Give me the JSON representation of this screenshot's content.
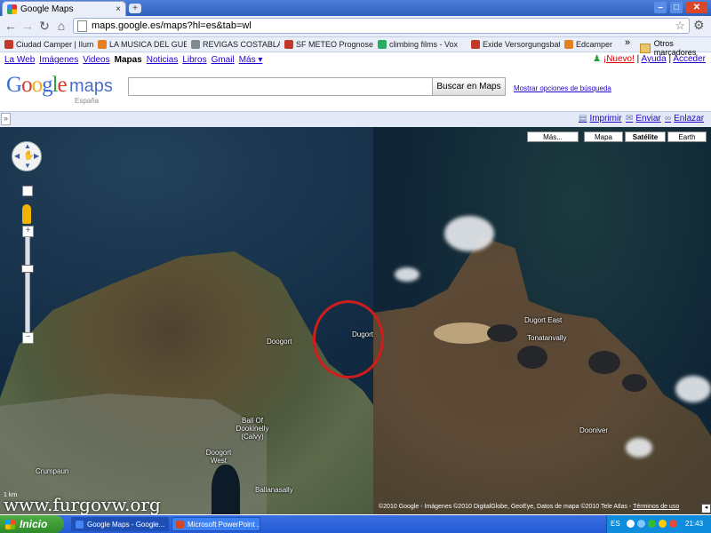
{
  "browser": {
    "tab_title": "Google Maps",
    "tab_close": "×",
    "new_tab": "+",
    "url": "maps.google.es/maps?hl=es&tab=wl",
    "window_buttons": {
      "minimize": "–",
      "maximize": "□",
      "close": "✕"
    }
  },
  "bookmarks": [
    {
      "label": "Ciudad Camper | Ilumi...",
      "color": "#c0392b"
    },
    {
      "label": "LA MUSICA DEL GUET...",
      "color": "#e67e22"
    },
    {
      "label": "REVIGAS COSTABLAN...",
      "color": "#7f8c8d"
    },
    {
      "label": "SF METEO Prognosen...",
      "color": "#c0392b"
    },
    {
      "label": "climbing films - Vox",
      "color": "#27ae60"
    },
    {
      "label": "Exide Versorgungsbat...",
      "color": "#c0392b"
    },
    {
      "label": "Edcamper",
      "color": "#e67e22"
    }
  ],
  "bookmarks_more": "»",
  "bookmarks_other": "Otros marcadores",
  "gbar": {
    "links": [
      "La Web",
      "Imágenes",
      "Videos",
      "Mapas",
      "Noticias",
      "Libros",
      "Gmail",
      "Más ▾"
    ],
    "current": "Mapas",
    "nuevo": "¡Nuevo!",
    "ayuda": "Ayuda",
    "acceder": "Acceder",
    "sep": "|"
  },
  "logo": {
    "google": "Google",
    "maps": "maps",
    "region": "España"
  },
  "search": {
    "value": "",
    "button": "Buscar en Maps",
    "options": "Mostrar opciones de búsqueda"
  },
  "linkbar": {
    "collapse": "»",
    "print": "Imprimir",
    "send": "Enviar",
    "link": "Enlazar"
  },
  "map": {
    "types": [
      "Más...",
      "Mapa",
      "Satélite",
      "Earth"
    ],
    "active_type": "Satélite",
    "labels": [
      {
        "text": "Doogort"
      },
      {
        "text": "Dugort"
      },
      {
        "text": "Dugort East"
      },
      {
        "text": "Tonatanvally"
      },
      {
        "text": "Ball Of Dookinelly (Calvy)"
      },
      {
        "text": "Doogort West"
      },
      {
        "text": "Crumpaun"
      },
      {
        "text": "Ballanasally"
      },
      {
        "text": "Dooniver"
      }
    ],
    "copyright": "©2010 Google - Imágenes ©2010 DigitalGlobe, GeoEye, Datos de mapa ©2010 Tele Atlas -",
    "terms": "Términos de uso",
    "scale": "1 km",
    "watermark": "www.furgovw.org",
    "zoom_in": "+",
    "zoom_out": "−"
  },
  "taskbar": {
    "start": "Inicio",
    "items": [
      {
        "label": "Google Maps - Google...",
        "color": "#4285f4"
      },
      {
        "label": "Microsoft PowerPoint ...",
        "color": "#d24726"
      }
    ],
    "lang": "ES",
    "clock": "21:43"
  }
}
